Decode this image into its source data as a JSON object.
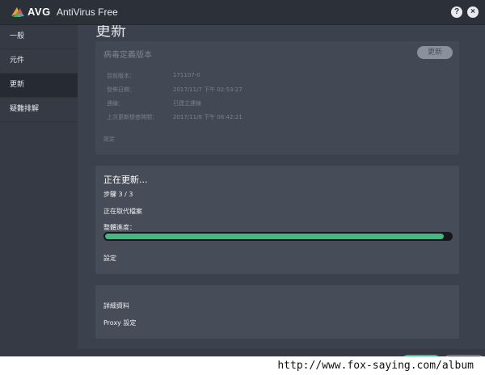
{
  "app": {
    "logo_text": "AVG",
    "title": "AntiVirus Free",
    "help_label": "?",
    "close_label": "×"
  },
  "sidebar": {
    "items": [
      {
        "label": "一般"
      },
      {
        "label": "元件"
      },
      {
        "label": "更新"
      },
      {
        "label": "疑難排解"
      }
    ]
  },
  "main": {
    "page_title": "更新",
    "definitions_panel": {
      "title": "病毒定義版本",
      "update_button_label": "更新",
      "rows": [
        {
          "label": "目前版本：",
          "value": "171107-0"
        },
        {
          "label": "發佈日期：",
          "value": "2017/11/7 下午 02:53:27"
        },
        {
          "label": "連線：",
          "value": "已建立連線"
        },
        {
          "label": "上次更新檢查時間：",
          "value": "2017/11/8 下午 06:42:21"
        }
      ],
      "settings_label": "設定"
    },
    "progress_panel": {
      "title": "正在更新...",
      "step": "步驟 3 / 3",
      "status": "正在取代檔案",
      "overall_label": "整體進度：",
      "progress_percent": 98,
      "settings_label": "設定"
    },
    "links_panel": {
      "details_label": "詳細資料",
      "proxy_label": "Proxy 設定"
    }
  },
  "watermark": "http://www.fox-saying.com/album",
  "colors": {
    "accent_green": "#43b97f",
    "sidebar_active": "#262a32"
  }
}
